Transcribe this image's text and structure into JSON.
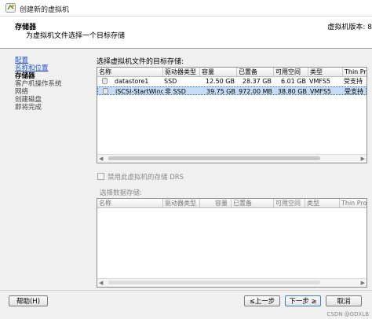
{
  "window": {
    "title": "创建新的虚拟机"
  },
  "header": {
    "title": "存储器",
    "subtitle": "为虚拟机文件选择一个目标存储",
    "right_text": "虚拟机版本: 8"
  },
  "steps": [
    {
      "label": "配置",
      "state": "link"
    },
    {
      "label": "名称和位置",
      "state": "link"
    },
    {
      "label": "存储器",
      "state": "current"
    },
    {
      "label": "客户机操作系统",
      "state": "pending"
    },
    {
      "label": "网络",
      "state": "pending"
    },
    {
      "label": "创建磁盘",
      "state": "pending"
    },
    {
      "label": "即将完成",
      "state": "pending"
    }
  ],
  "main": {
    "label": "选择虚拟机文件的目标存储:",
    "columns": [
      "名称",
      "驱动器类型",
      "容量",
      "已置备",
      "可用空间",
      "类型",
      "Thin Prov"
    ],
    "rows": [
      {
        "name": "datastore1",
        "drive": "SSD",
        "capacity": "12.50 GB",
        "provisioned": "28.37 GB",
        "free": "6.01 GB",
        "type": "VMFS5",
        "thin": "受支持"
      },
      {
        "name": "iSCSI-StartWind",
        "drive": "非 SSD",
        "capacity": "39.75 GB",
        "provisioned": "972.00 MB",
        "free": "38.80 GB",
        "type": "VMFS5",
        "thin": "受支持"
      }
    ],
    "selected_row": 1,
    "scroll_left": "◀",
    "scroll_right": "▶"
  },
  "drs": {
    "label": "禁用此虚拟机的存储 DRS",
    "checked": false
  },
  "cluster": {
    "label": "选择数据存储:",
    "columns": [
      "名称",
      "驱动器类型",
      "容量",
      "已置备",
      "可用空间",
      "类型",
      "Thin Prov"
    ],
    "scroll_left": "◀",
    "scroll_right": "▶"
  },
  "buttons": {
    "help": "帮助(H)",
    "back": "≤上一步",
    "next": "下一步 ≥",
    "cancel": "取消"
  },
  "watermark": "CSDN @GDXLB"
}
